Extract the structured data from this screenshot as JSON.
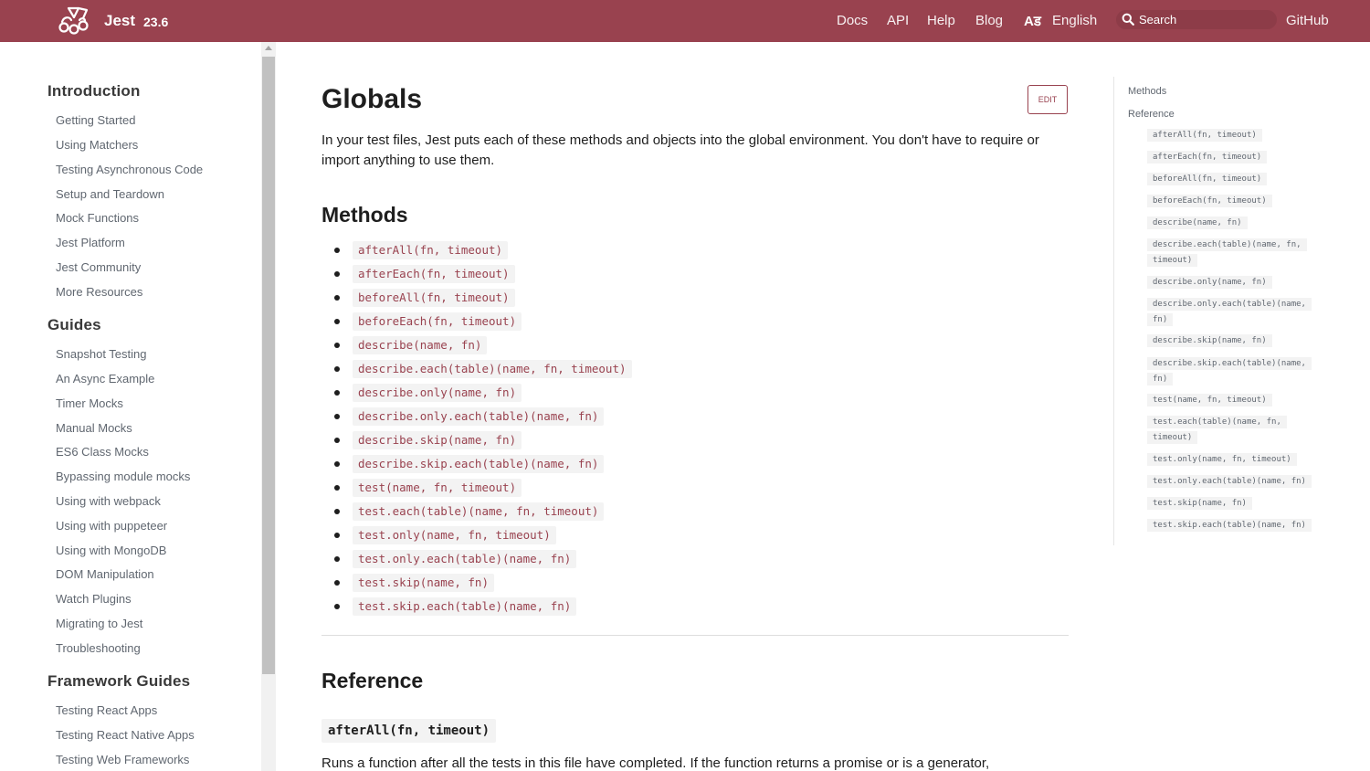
{
  "header": {
    "brand": "Jest",
    "version": "23.6",
    "nav": [
      "Docs",
      "API",
      "Help",
      "Blog"
    ],
    "language": "English",
    "search_placeholder": "Search",
    "github": "GitHub",
    "background_color": "#99424f"
  },
  "sidebar": {
    "categories": [
      {
        "title": "Introduction",
        "items": [
          "Getting Started",
          "Using Matchers",
          "Testing Asynchronous Code",
          "Setup and Teardown",
          "Mock Functions",
          "Jest Platform",
          "Jest Community",
          "More Resources"
        ]
      },
      {
        "title": "Guides",
        "items": [
          "Snapshot Testing",
          "An Async Example",
          "Timer Mocks",
          "Manual Mocks",
          "ES6 Class Mocks",
          "Bypassing module mocks",
          "Using with webpack",
          "Using with puppeteer",
          "Using with MongoDB",
          "DOM Manipulation",
          "Watch Plugins",
          "Migrating to Jest",
          "Troubleshooting"
        ]
      },
      {
        "title": "Framework Guides",
        "items": [
          "Testing React Apps",
          "Testing React Native Apps",
          "Testing Web Frameworks"
        ]
      }
    ]
  },
  "main": {
    "title": "Globals",
    "edit_label": "EDIT",
    "intro": "In your test files, Jest puts each of these methods and objects into the global environment. You don't have to require or import anything to use them.",
    "methods_heading": "Methods",
    "methods": [
      "afterAll(fn, timeout)",
      "afterEach(fn, timeout)",
      "beforeAll(fn, timeout)",
      "beforeEach(fn, timeout)",
      "describe(name, fn)",
      "describe.each(table)(name, fn, timeout)",
      "describe.only(name, fn)",
      "describe.only.each(table)(name, fn)",
      "describe.skip(name, fn)",
      "describe.skip.each(table)(name, fn)",
      "test(name, fn, timeout)",
      "test.each(table)(name, fn, timeout)",
      "test.only(name, fn, timeout)",
      "test.only.each(table)(name, fn)",
      "test.skip(name, fn)",
      "test.skip.each(table)(name, fn)"
    ],
    "reference_heading": "Reference",
    "reference_first_code": "afterAll(fn, timeout)",
    "reference_first_desc": "Runs a function after all the tests in this file have completed. If the function returns a promise or is a generator,"
  },
  "toc": {
    "methods": "Methods",
    "reference": "Reference",
    "items": [
      "afterAll(fn, timeout)",
      "afterEach(fn, timeout)",
      "beforeAll(fn, timeout)",
      "beforeEach(fn, timeout)",
      "describe(name, fn)",
      "describe.each(table)(name, fn, timeout)",
      "describe.only(name, fn)",
      "describe.only.each(table)(name, fn)",
      "describe.skip(name, fn)",
      "describe.skip.each(table)(name, fn)",
      "test(name, fn, timeout)",
      "test.each(table)(name, fn, timeout)",
      "test.only(name, fn, timeout)",
      "test.only.each(table)(name, fn)",
      "test.skip(name, fn)",
      "test.skip.each(table)(name, fn)"
    ]
  }
}
